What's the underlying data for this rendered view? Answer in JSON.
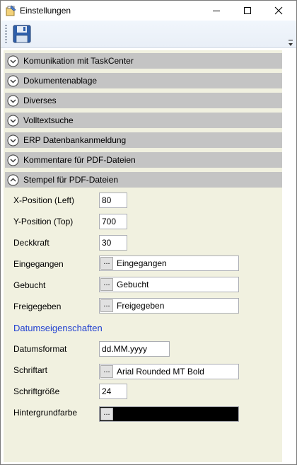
{
  "window": {
    "title": "Einstellungen",
    "controls": {
      "minimize": "minimize-icon",
      "maximize": "maximize-icon",
      "close": "close-icon"
    }
  },
  "toolbar": {
    "save_icon": "floppy-disk-icon",
    "overflow_icon": "toolbar-overflow-icon"
  },
  "sections": [
    {
      "label": "Komunikation mit TaskCenter",
      "expanded": false
    },
    {
      "label": "Dokumentenablage",
      "expanded": false
    },
    {
      "label": "Diverses",
      "expanded": false
    },
    {
      "label": "Volltextsuche",
      "expanded": false
    },
    {
      "label": "ERP Datenbankanmeldung",
      "expanded": false
    },
    {
      "label": "Kommentare für PDF-Dateien",
      "expanded": false
    },
    {
      "label": "Stempel für PDF-Dateien",
      "expanded": true
    }
  ],
  "stamp": {
    "x_label": "X-Position (Left)",
    "x_value": "80",
    "y_label": "Y-Position (Top)",
    "y_value": "700",
    "opacity_label": "Deckkraft",
    "opacity_value": "30",
    "received_label": "Eingegangen",
    "received_value": "Eingegangen",
    "booked_label": "Gebucht",
    "booked_value": "Gebucht",
    "approved_label": "Freigegeben",
    "approved_value": "Freigegeben",
    "browse": "..."
  },
  "date": {
    "heading": "Datumseigenschaften",
    "format_label": "Datumsformat",
    "format_value": "dd.MM.yyyy",
    "font_label": "Schriftart",
    "font_value": "Arial Rounded MT Bold",
    "size_label": "Schriftgröße",
    "size_value": "24",
    "bg_label": "Hintergrundfarbe",
    "bg_color": "#000000"
  },
  "colors": {
    "accent": "#1f3fd1",
    "panel": "#f1f1e0",
    "header": "#c4c4c4"
  }
}
